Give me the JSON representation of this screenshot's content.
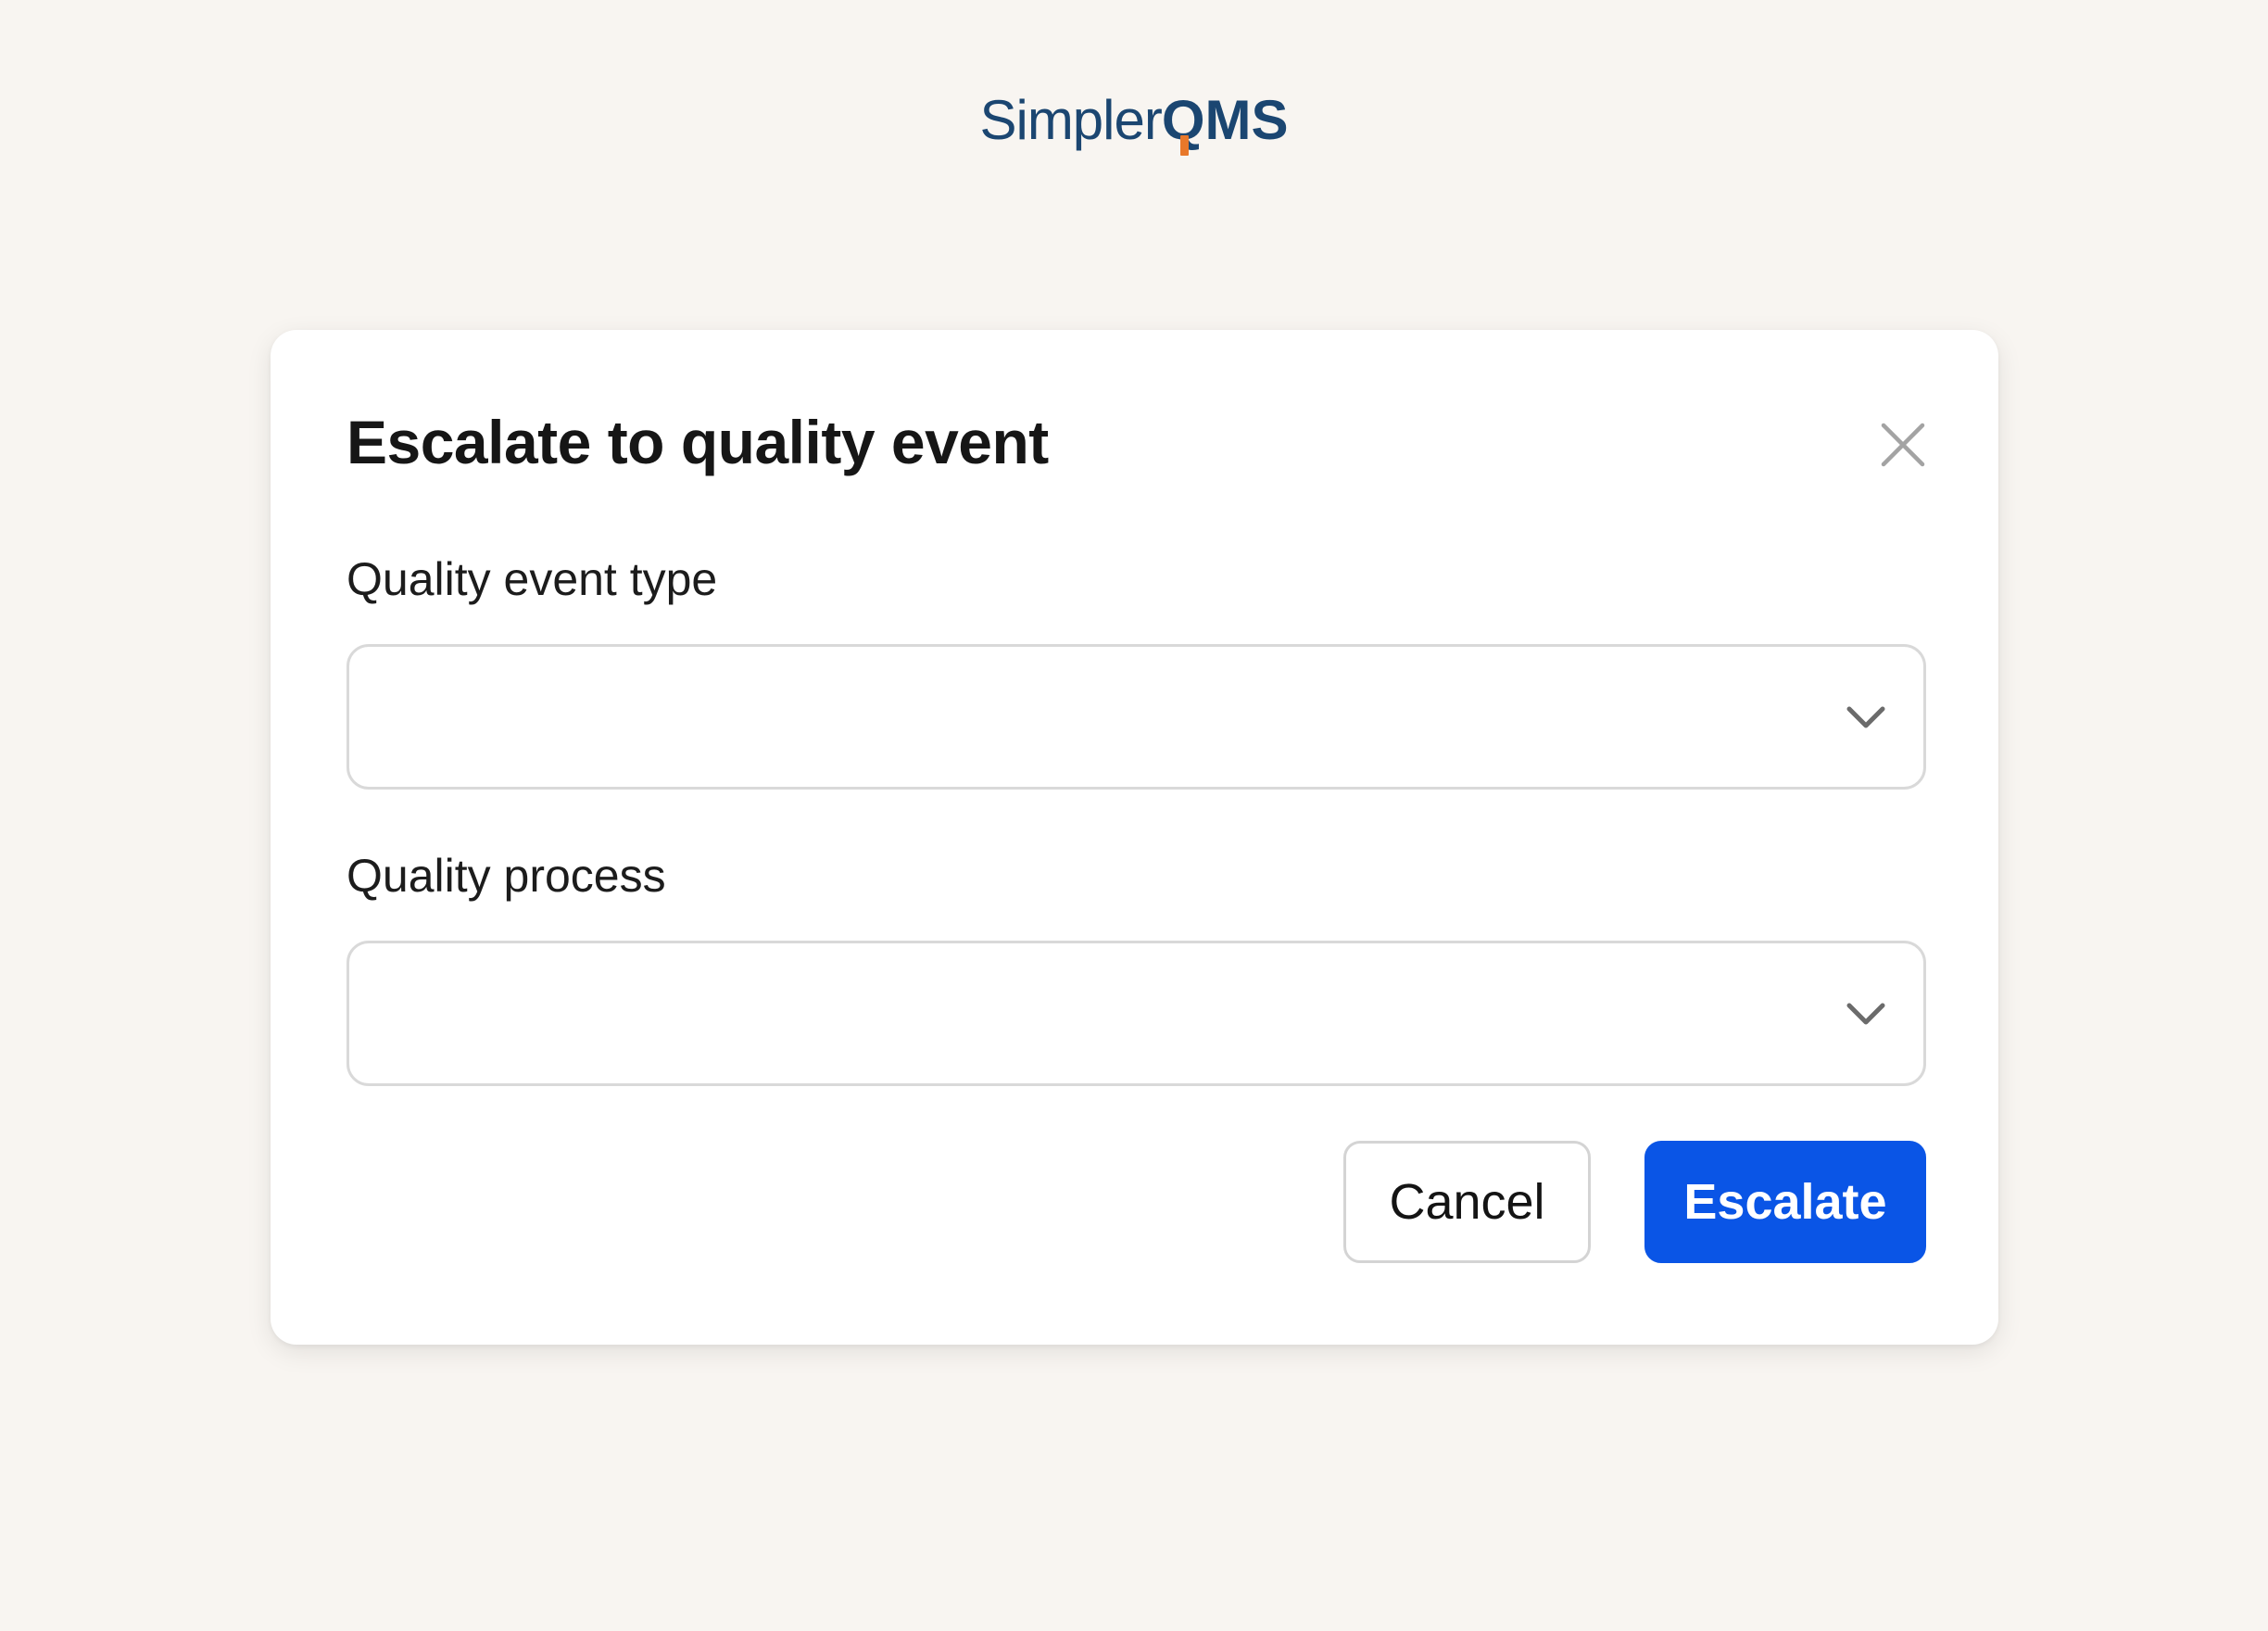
{
  "app": {
    "logo_text_light": "Simpler",
    "logo_text_bold_q": "Q",
    "logo_text_bold_rest": "MS",
    "brand_color": "#1b4671",
    "logo_accent_color": "#e8782a"
  },
  "dialog": {
    "title": "Escalate to quality event",
    "close_icon": "close-icon",
    "fields": {
      "quality_event_type": {
        "label": "Quality event type",
        "value": "",
        "icon": "chevron-down-icon"
      },
      "quality_process": {
        "label": "Quality process",
        "value": "",
        "icon": "chevron-down-icon"
      }
    },
    "actions": {
      "cancel_label": "Cancel",
      "escalate_label": "Escalate",
      "primary_color": "#0a55e6"
    }
  }
}
